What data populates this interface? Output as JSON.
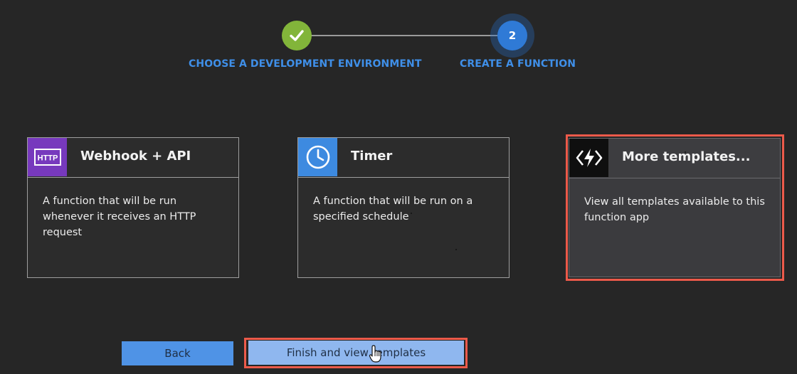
{
  "stepper": {
    "steps": [
      {
        "label": "CHOOSE A DEVELOPMENT ENVIRONMENT",
        "state": "completed",
        "icon": "check-icon"
      },
      {
        "label": "CREATE A FUNCTION",
        "number": "2",
        "state": "active"
      }
    ],
    "colors": {
      "completed": "#82b53a",
      "active": "#2f7ad6",
      "label": "#3f8fe8"
    }
  },
  "cards": [
    {
      "title": "Webhook + API",
      "description": "A function that will be run whenever it receives an HTTP request",
      "icon": "http-icon",
      "icon_text": "HTTP",
      "icon_color": "#7739bd"
    },
    {
      "title": "Timer",
      "description": "A function that will be run on a specified schedule",
      "icon": "clock-icon",
      "icon_color": "#3d8ae0"
    },
    {
      "title": "More templates...",
      "description": "View all templates available to this function app",
      "icon": "function-lightning-icon",
      "icon_color": "#0f0f0f",
      "highlighted": true
    }
  ],
  "buttons": {
    "back_label": "Back",
    "finish_label": "Finish and view templates"
  },
  "highlight_color": "#ec5a4a"
}
